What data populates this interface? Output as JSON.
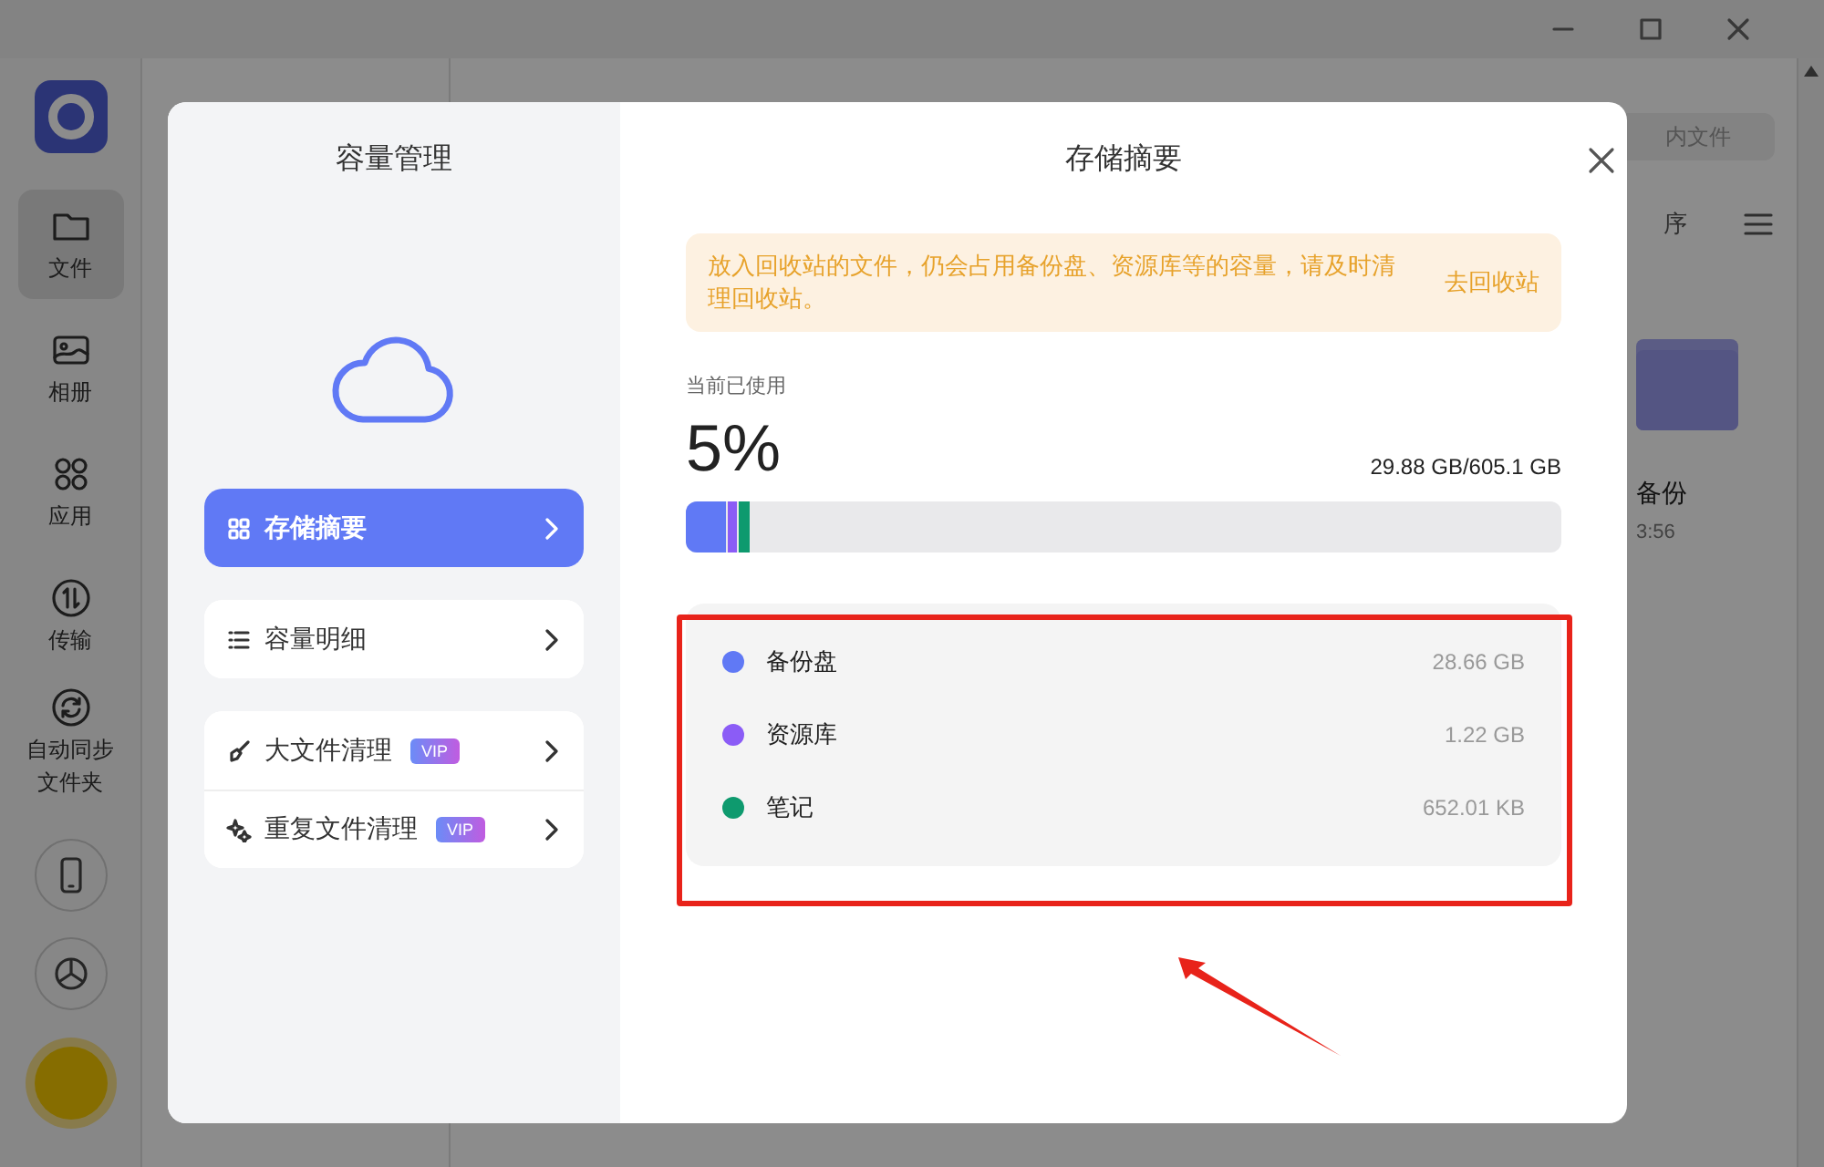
{
  "app": {
    "sidebar": [
      {
        "kind": "folder",
        "label": "文件",
        "selected": true
      },
      {
        "kind": "photo",
        "label": "相册",
        "selected": false
      },
      {
        "kind": "apps",
        "label": "应用",
        "selected": false
      },
      {
        "kind": "transfer",
        "label": "传输",
        "selected": false
      },
      {
        "kind": "sync",
        "label": "自动同步文件夹",
        "selected": false
      }
    ],
    "search": {
      "placeholder": "内文件"
    },
    "sort_label": "序",
    "file": {
      "name": "备份",
      "time": "3:56"
    }
  },
  "dialog": {
    "title": "容量管理",
    "menu": [
      {
        "items": [
          {
            "kind": "grid",
            "label": "存储摘要",
            "selected": true
          }
        ]
      },
      {
        "items": [
          {
            "kind": "list",
            "label": "容量明细",
            "selected": false
          }
        ]
      },
      {
        "items": [
          {
            "kind": "broom",
            "label": "大文件清理",
            "selected": false,
            "badge": "VIP"
          },
          {
            "kind": "dup",
            "label": "重复文件清理",
            "selected": false,
            "badge": "VIP"
          }
        ]
      }
    ],
    "panel": {
      "title": "存储摘要",
      "notice": "放入回收站的文件，仍会占用备份盘、资源库等的容量，请及时清理回收站。",
      "notice_link": "去回收站",
      "used_label": "当前已使用",
      "percent": "5%",
      "total": "29.88 GB/605.1 GB",
      "items": [
        {
          "name": "备份盘",
          "size": "28.66 GB",
          "color": "#6079f5",
          "level": 0.046
        },
        {
          "name": "资源库",
          "size": "1.22 GB",
          "color": "#8b5cf6",
          "level": 0.01
        },
        {
          "name": "笔记",
          "size": "652.01 KB",
          "color": "#0e9a6e",
          "level": 0.012
        }
      ]
    }
  }
}
